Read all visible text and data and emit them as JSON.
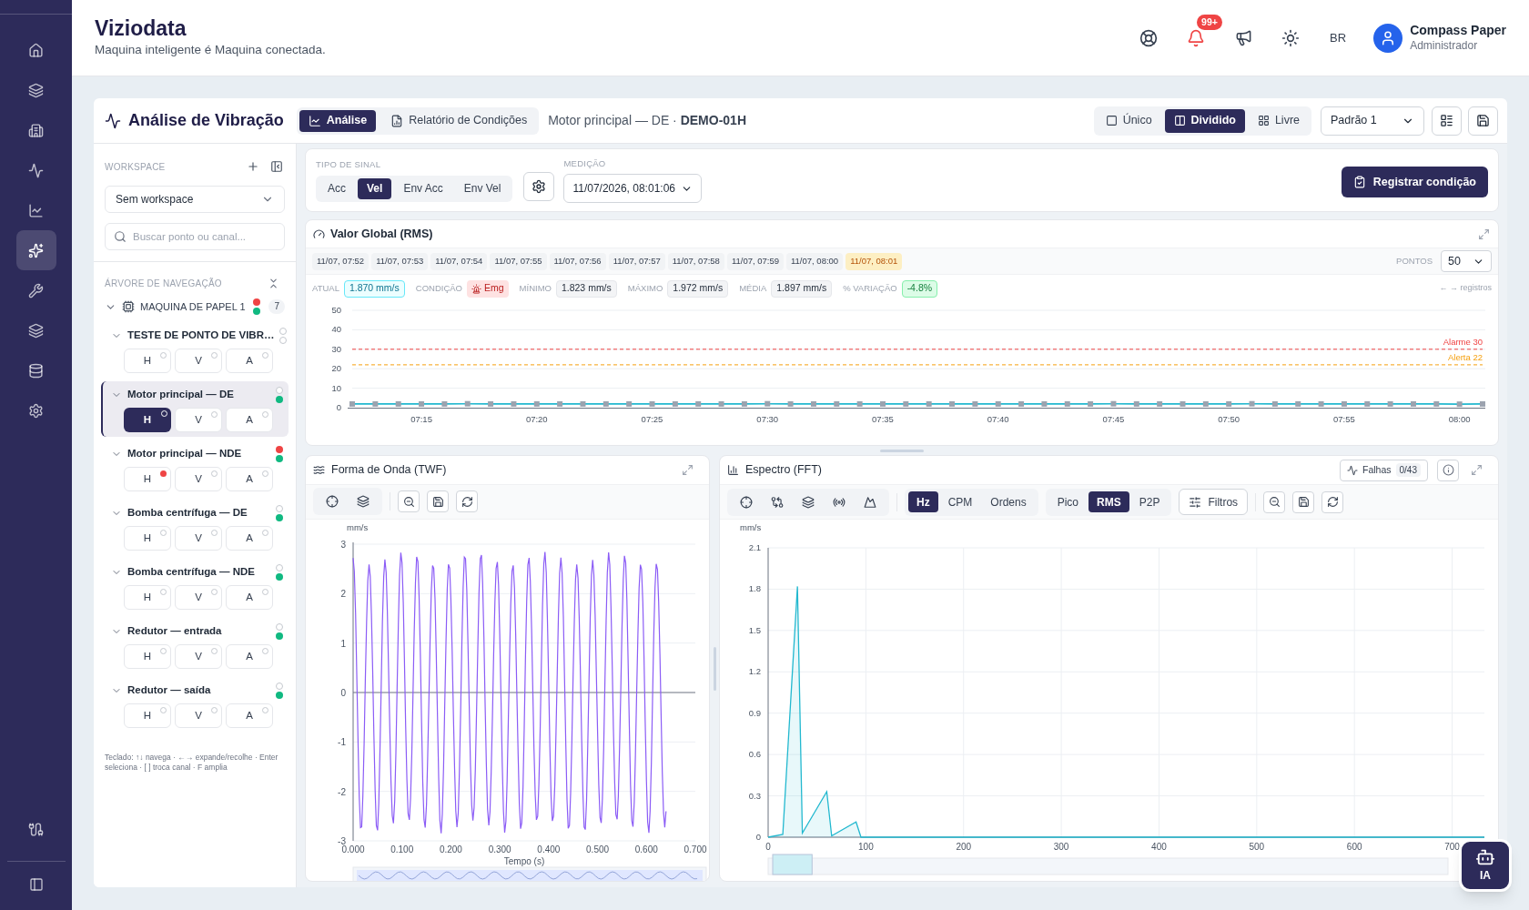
{
  "sidebar": {
    "items": [
      {
        "selected": false
      },
      {
        "selected": false
      },
      {
        "selected": false
      },
      {
        "selected": false
      },
      {
        "selected": false
      },
      {
        "selected": true
      },
      {
        "selected": false
      },
      {
        "selected": false
      },
      {
        "selected": false
      },
      {
        "selected": false
      }
    ]
  },
  "header": {
    "app_title": "Viziodata",
    "tagline": "Maquina inteligente é Maquina conectada.",
    "notifications_badge": "99+",
    "language": "BR",
    "user": {
      "name": "Compass Paper",
      "role": "Administrador"
    }
  },
  "toolbar": {
    "title": "Análise de Vibração",
    "tabs": [
      {
        "label": "Análise",
        "selected": true
      },
      {
        "label": "Relatório de Condições",
        "selected": false
      }
    ],
    "breadcrumb": "Motor principal — DE · **DEMO-01H**",
    "layouts": [
      {
        "label": "Único",
        "selected": false
      },
      {
        "label": "Dividido",
        "selected": true
      },
      {
        "label": "Livre",
        "selected": false
      }
    ],
    "preset": "Padrão 1"
  },
  "left_panel": {
    "workspace_label": "WORKSPACE",
    "workspace": "Sem workspace",
    "search": {
      "placeholder": "Buscar ponto ou canal..."
    },
    "tree_label": "ÁRVORE DE NAVEGAÇÃO",
    "tree": [
      {
        "label": "MAQUINA DE PAPEL 1",
        "expanded": true,
        "alarm": true,
        "ok": true,
        "count": "7",
        "children": [
          {
            "label": "TESTE DE PONTO DE VIBR…",
            "expanded": true,
            "selected": false,
            "alarm": false,
            "ok": false,
            "channels": [
              {
                "label": "H",
                "selected": false,
                "alarm": false
              },
              {
                "label": "V",
                "selected": false,
                "alarm": false
              },
              {
                "label": "A",
                "selected": false,
                "alarm": false
              }
            ]
          },
          {
            "label": "Motor principal — DE",
            "expanded": true,
            "selected": true,
            "alarm": false,
            "ok": true,
            "channels": [
              {
                "label": "H",
                "selected": true,
                "alarm": false
              },
              {
                "label": "V",
                "selected": false,
                "alarm": false
              },
              {
                "label": "A",
                "selected": false,
                "alarm": false
              }
            ]
          },
          {
            "label": "Motor principal — NDE",
            "expanded": true,
            "selected": false,
            "alarm": true,
            "ok": true,
            "channels": [
              {
                "label": "H",
                "selected": false,
                "alarm": true
              },
              {
                "label": "V",
                "selected": false,
                "alarm": false
              },
              {
                "label": "A",
                "selected": false,
                "alarm": false
              }
            ]
          },
          {
            "label": "Bomba centrífuga — DE",
            "expanded": true,
            "selected": false,
            "alarm": false,
            "ok": true,
            "channels": [
              {
                "label": "H",
                "selected": false,
                "alarm": false
              },
              {
                "label": "V",
                "selected": false,
                "alarm": false
              },
              {
                "label": "A",
                "selected": false,
                "alarm": false
              }
            ]
          },
          {
            "label": "Bomba centrífuga — NDE",
            "expanded": true,
            "selected": false,
            "alarm": false,
            "ok": true,
            "channels": [
              {
                "label": "H",
                "selected": false,
                "alarm": false
              },
              {
                "label": "V",
                "selected": false,
                "alarm": false
              },
              {
                "label": "A",
                "selected": false,
                "alarm": false
              }
            ]
          },
          {
            "label": "Redutor — entrada",
            "expanded": true,
            "selected": false,
            "alarm": false,
            "ok": true,
            "channels": [
              {
                "label": "H",
                "selected": false,
                "alarm": false
              },
              {
                "label": "V",
                "selected": false,
                "alarm": false
              },
              {
                "label": "A",
                "selected": false,
                "alarm": false
              }
            ]
          },
          {
            "label": "Redutor — saída",
            "expanded": true,
            "selected": false,
            "alarm": false,
            "ok": true,
            "channels": [
              {
                "label": "H",
                "selected": false,
                "alarm": false
              },
              {
                "label": "V",
                "selected": false,
                "alarm": false
              },
              {
                "label": "A",
                "selected": false,
                "alarm": false
              }
            ]
          }
        ]
      }
    ],
    "hint": "Teclado: ↑↓ navega · ←→ expande/recolhe · Enter seleciona · [ ] troca canal · F amplia"
  },
  "signal": {
    "type_label": "TIPO DE SINAL",
    "types": [
      {
        "label": "Acc",
        "selected": false
      },
      {
        "label": "Vel",
        "selected": true
      },
      {
        "label": "Env Acc",
        "selected": false
      },
      {
        "label": "Env Vel",
        "selected": false
      }
    ],
    "measurement_label": "MEDIÇÃO",
    "measurement": "11/07/2026, 08:01:06",
    "register_button": "Registrar condição"
  },
  "rms": {
    "title": "Valor Global (RMS)",
    "timestamps": [
      {
        "label": "11/07, 07:52",
        "selected": false
      },
      {
        "label": "11/07, 07:53",
        "selected": false
      },
      {
        "label": "11/07, 07:54",
        "selected": false
      },
      {
        "label": "11/07, 07:55",
        "selected": false
      },
      {
        "label": "11/07, 07:56",
        "selected": false
      },
      {
        "label": "11/07, 07:57",
        "selected": false
      },
      {
        "label": "11/07, 07:58",
        "selected": false
      },
      {
        "label": "11/07, 07:59",
        "selected": false
      },
      {
        "label": "11/07, 08:00",
        "selected": false
      },
      {
        "label": "11/07, 08:01",
        "selected": true
      }
    ],
    "points_label": "PONTOS",
    "points": "50",
    "stats": [
      {
        "label": "ATUAL",
        "value": "1.870 mm/s",
        "kind": "info"
      },
      {
        "label": "CONDIÇÃO",
        "value": "Emg",
        "kind": "danger"
      },
      {
        "label": "MÍNIMO",
        "value": "1.823 mm/s",
        "kind": "neutral"
      },
      {
        "label": "MÁXIMO",
        "value": "1.972 mm/s",
        "kind": "neutral"
      },
      {
        "label": "MÉDIA",
        "value": "1.897 mm/s",
        "kind": "neutral"
      },
      {
        "label": "% VARIAÇÃO",
        "value": "-4.8%",
        "kind": "success"
      }
    ],
    "records_hint": "← → registros",
    "chart_data": {
      "type": "line",
      "categories": [
        null,
        null,
        null,
        "07:15",
        null,
        null,
        null,
        null,
        "07:20",
        null,
        null,
        null,
        null,
        "07:25",
        null,
        null,
        null,
        null,
        "07:30",
        null,
        null,
        null,
        null,
        "07:35",
        null,
        null,
        null,
        null,
        "07:40",
        null,
        null,
        null,
        null,
        "07:45",
        null,
        null,
        null,
        null,
        "07:50",
        null,
        null,
        null,
        null,
        "07:55",
        null,
        null,
        null,
        null,
        "08:00",
        null
      ],
      "ylim": [
        0,
        50
      ],
      "yticks": [
        0,
        10,
        20,
        30,
        40,
        50
      ],
      "grid": true,
      "series": [
        {
          "color": "#22b8cf",
          "marker": "square",
          "values": [
            1.9,
            1.9,
            1.9,
            1.9,
            1.9,
            2.0,
            1.9,
            1.9,
            1.9,
            1.9,
            1.9,
            1.9,
            1.9,
            1.9,
            1.9,
            1.9,
            1.9,
            1.9,
            2.0,
            1.9,
            1.9,
            1.9,
            1.9,
            1.9,
            1.9,
            1.9,
            1.9,
            1.9,
            1.9,
            1.9,
            1.9,
            1.9,
            1.9,
            2.0,
            1.9,
            1.9,
            1.9,
            1.9,
            1.9,
            2.0,
            1.9,
            1.9,
            1.9,
            1.9,
            1.9,
            1.9,
            1.9,
            1.9,
            1.8,
            1.9
          ]
        },
        {
          "name": "Alarme 30",
          "color": "#ef4444",
          "line_style": "dashed",
          "values": [
            30,
            30,
            30,
            30,
            30,
            30,
            30,
            30,
            30,
            30,
            30,
            30,
            30,
            30,
            30,
            30,
            30,
            30,
            30,
            30,
            30,
            30,
            30,
            30,
            30,
            30,
            30,
            30,
            30,
            30,
            30,
            30,
            30,
            30,
            30,
            30,
            30,
            30,
            30,
            30,
            30,
            30,
            30,
            30,
            30,
            30,
            30,
            30,
            30,
            30
          ]
        },
        {
          "name": "Alerta 22",
          "color": "#f59e0b",
          "line_style": "dashed",
          "values": [
            22,
            22,
            22,
            22,
            22,
            22,
            22,
            22,
            22,
            22,
            22,
            22,
            22,
            22,
            22,
            22,
            22,
            22,
            22,
            22,
            22,
            22,
            22,
            22,
            22,
            22,
            22,
            22,
            22,
            22,
            22,
            22,
            22,
            22,
            22,
            22,
            22,
            22,
            22,
            22,
            22,
            22,
            22,
            22,
            22,
            22,
            22,
            22,
            22,
            22
          ]
        }
      ]
    }
  },
  "twf": {
    "title": "Forma de Onda (TWF)",
    "unit": "mm/s",
    "yticks": [
      "3",
      "2",
      "1",
      "0",
      "-1",
      "-2",
      "-3"
    ],
    "xticks": [
      "0.000",
      "0.100",
      "0.200",
      "0.300",
      "0.400",
      "0.500",
      "0.600",
      "0.700"
    ],
    "xlabel": "Tempo (s)",
    "zoom": {
      "level": 1
    }
  },
  "fft": {
    "title": "Espectro (FFT)",
    "faults_label": "Falhas",
    "faults_count": "0/43",
    "units": [
      {
        "label": "Hz",
        "selected": true
      },
      {
        "label": "CPM",
        "selected": false
      },
      {
        "label": "Ordens",
        "selected": false
      }
    ],
    "scales": [
      {
        "label": "Pico",
        "selected": false
      },
      {
        "label": "RMS",
        "selected": true
      },
      {
        "label": "P2P",
        "selected": false
      }
    ],
    "filters_button": "Filtros",
    "zoom": {
      "level": 0.055
    },
    "chart_data": {
      "type": "area",
      "ylabel": "mm/s",
      "grid": true,
      "x": [
        0,
        15,
        30,
        35,
        60,
        65,
        90,
        95,
        733
      ],
      "xlim": [
        0,
        733
      ],
      "ylim": [
        0,
        2.1
      ],
      "xticks": [
        0,
        100,
        200,
        300,
        400,
        500,
        600,
        700
      ],
      "yticks": [
        0,
        0.3,
        0.6,
        0.9,
        1.2,
        1.5,
        1.8,
        2.1
      ],
      "series": [
        {
          "color": "#22b8cf",
          "values": [
            0,
            0.02,
            1.82,
            0.03,
            0.33,
            0.01,
            0.11,
            0,
            0
          ]
        }
      ]
    }
  },
  "assistant": {
    "label": "IA"
  }
}
